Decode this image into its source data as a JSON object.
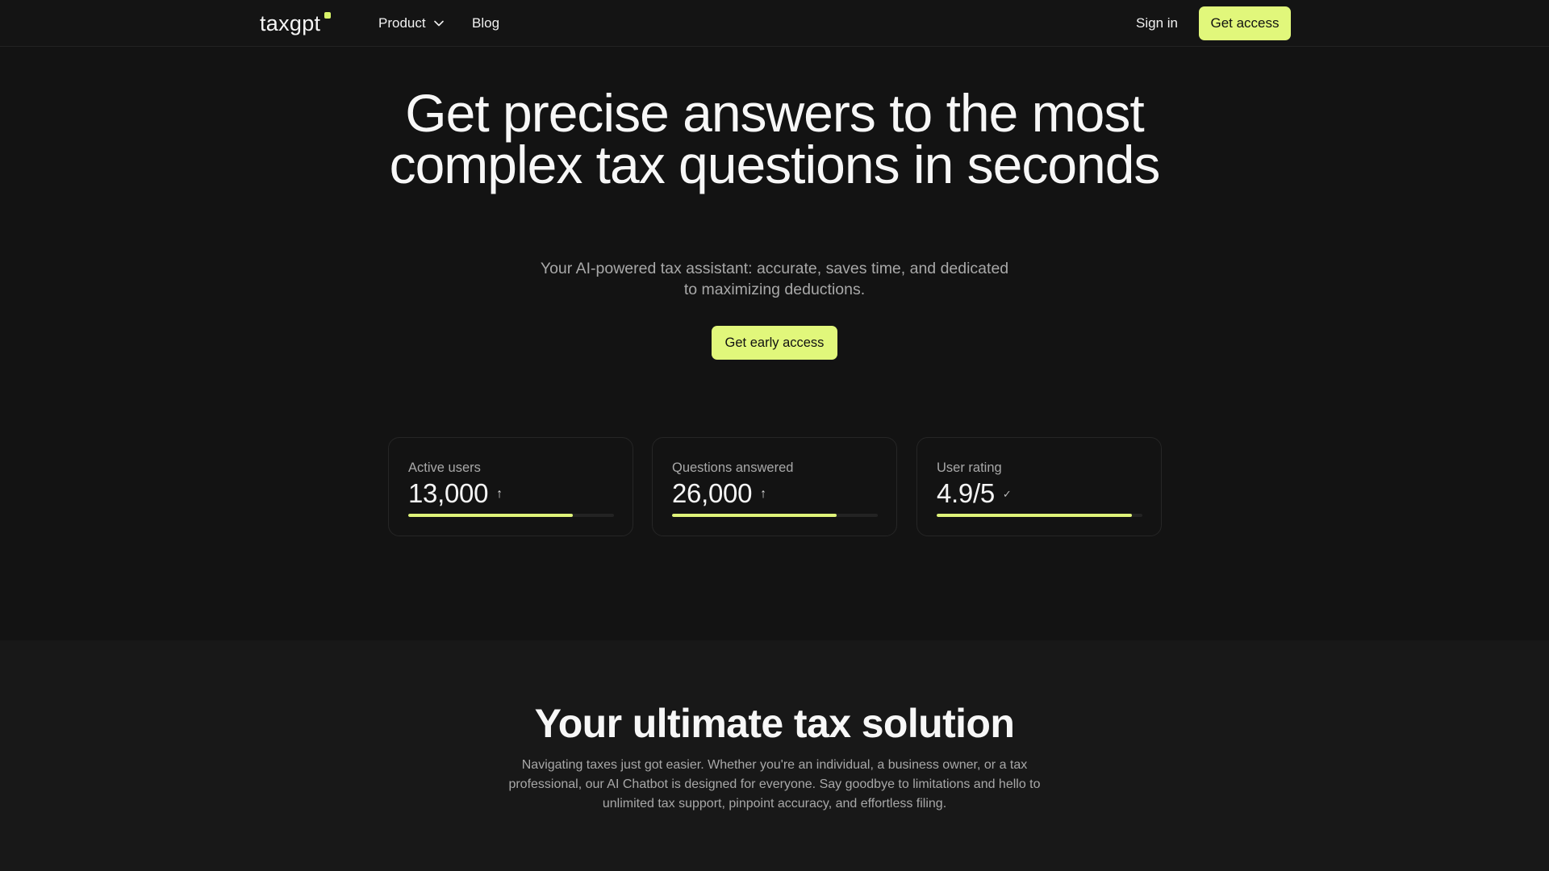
{
  "nav": {
    "logo": "taxgpt",
    "product_label": "Product",
    "blog_label": "Blog",
    "signin_label": "Sign in",
    "cta_label": "Get access"
  },
  "hero": {
    "title": "Get precise answers to the most complex tax questions in seconds",
    "subtitle": "Your AI-powered tax assistant: accurate, saves time, and dedicated to maximizing deductions.",
    "cta_label": "Get early access"
  },
  "stats": [
    {
      "label": "Active users",
      "value": "13,000",
      "icon": "arrow-up-icon",
      "progress": 0.8
    },
    {
      "label": "Questions answered",
      "value": "26,000",
      "icon": "arrow-up-icon",
      "progress": 0.8
    },
    {
      "label": "User rating",
      "value": "4.9/5",
      "icon": "check-icon",
      "progress": 0.95
    }
  ],
  "solution": {
    "title": "Your ultimate tax solution",
    "body": "Navigating taxes just got easier. Whether you're an individual, a business owner, or a tax professional, our AI Chatbot is designed for everyone. Say goodbye to limitations and hello to unlimited tax support, pinpoint accuracy, and effortless filing."
  },
  "colors": {
    "accent": "#e1f77b",
    "background": "#131313",
    "section_background": "#181818"
  }
}
